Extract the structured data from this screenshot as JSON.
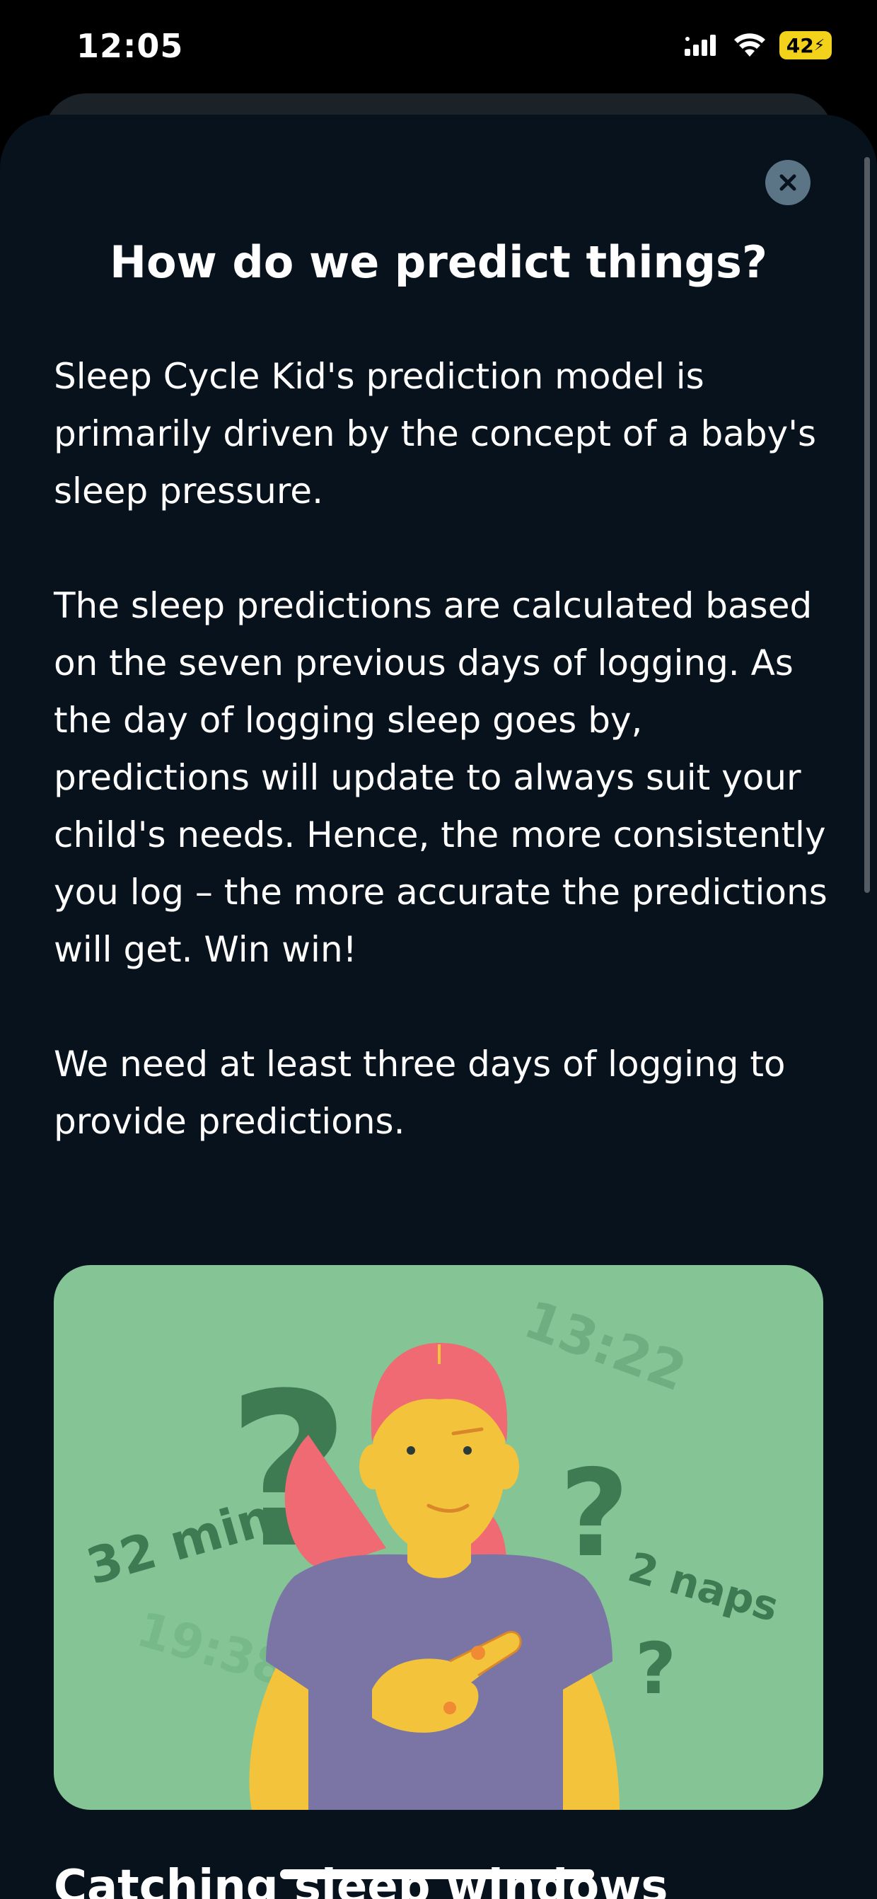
{
  "status_bar": {
    "time": "12:05",
    "battery": "42",
    "icons": [
      "cellular-signal-icon",
      "wifi-icon",
      "battery-charging-icon"
    ]
  },
  "modal": {
    "close_icon": "close-icon",
    "title": "How do we predict things?",
    "paragraphs": [
      "Sleep Cycle Kid's prediction model is primarily driven by the concept of a baby's sleep pressure.",
      "The sleep predictions are calculated based on the seven previous days of logging. As the day of logging sleep goes by, predictions will update to always suit your child's needs. Hence, the more consistently you log – the more accurate the predictions will get. Win win!",
      "We need at least three days of logging to provide predictions."
    ],
    "illustration": {
      "labels": {
        "time_1": "13:22",
        "duration": "32 min",
        "naps": "2 naps",
        "time_2": "19:38",
        "question": "?"
      }
    },
    "next_heading": "Catching sleep windows"
  },
  "colors": {
    "modal_bg": "#07121c",
    "illustration_bg": "#84c495",
    "accent_dark_green": "#3e7a52",
    "close_button_bg": "#5b7587"
  }
}
